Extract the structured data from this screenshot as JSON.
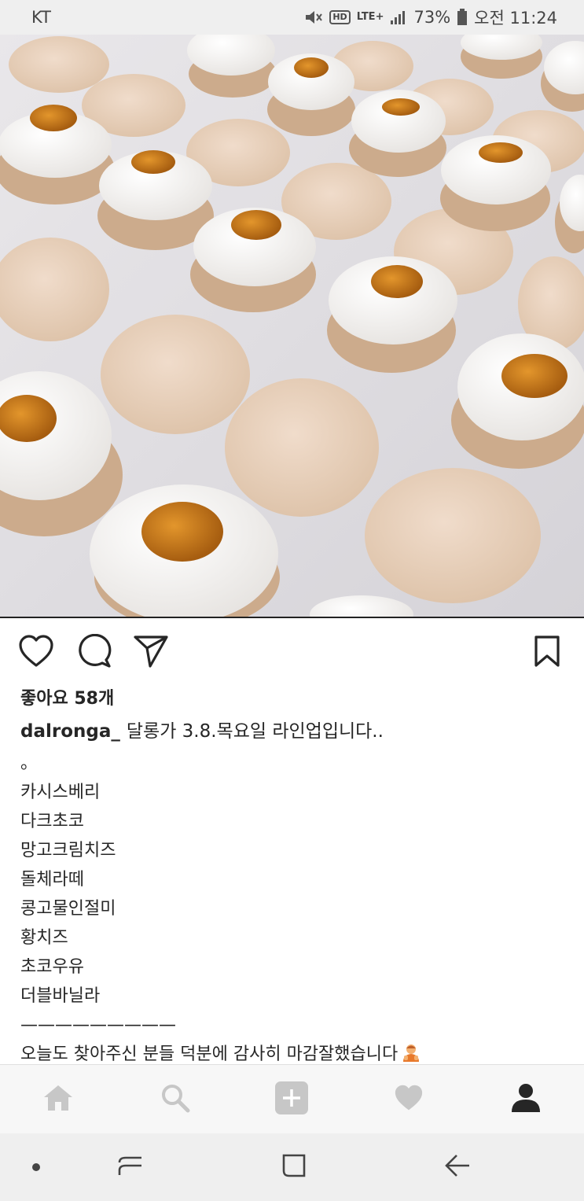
{
  "status_bar": {
    "carrier": "KT",
    "signal_label": "LTE+",
    "hd_label": "HD",
    "battery": "73%",
    "time": "오전 11:24"
  },
  "post": {
    "likes": "좋아요 58개",
    "username": "dalronga_",
    "caption": "달롱가 3.8.목요일 라인업입니다..",
    "lines": [
      "。",
      "카시스베리",
      "다크초코",
      "망고크림치즈",
      "돌체라떼",
      "콩고물인절미",
      "황치즈",
      "초코우유",
      "더블바닐라",
      "—————————",
      "오늘도 찾아주신 분들 덕분에 감사히 마감잘했습니다"
    ]
  },
  "icons": {
    "like": "heart-icon",
    "comment": "comment-icon",
    "share": "send-icon",
    "save": "bookmark-icon",
    "home": "home-icon",
    "search": "search-icon",
    "add": "add-icon",
    "activity": "heart-icon",
    "profile": "profile-icon"
  },
  "colors": {
    "icon_active": "#262626",
    "icon_inactive": "#c7c7c7",
    "system_nav": "#444444"
  }
}
